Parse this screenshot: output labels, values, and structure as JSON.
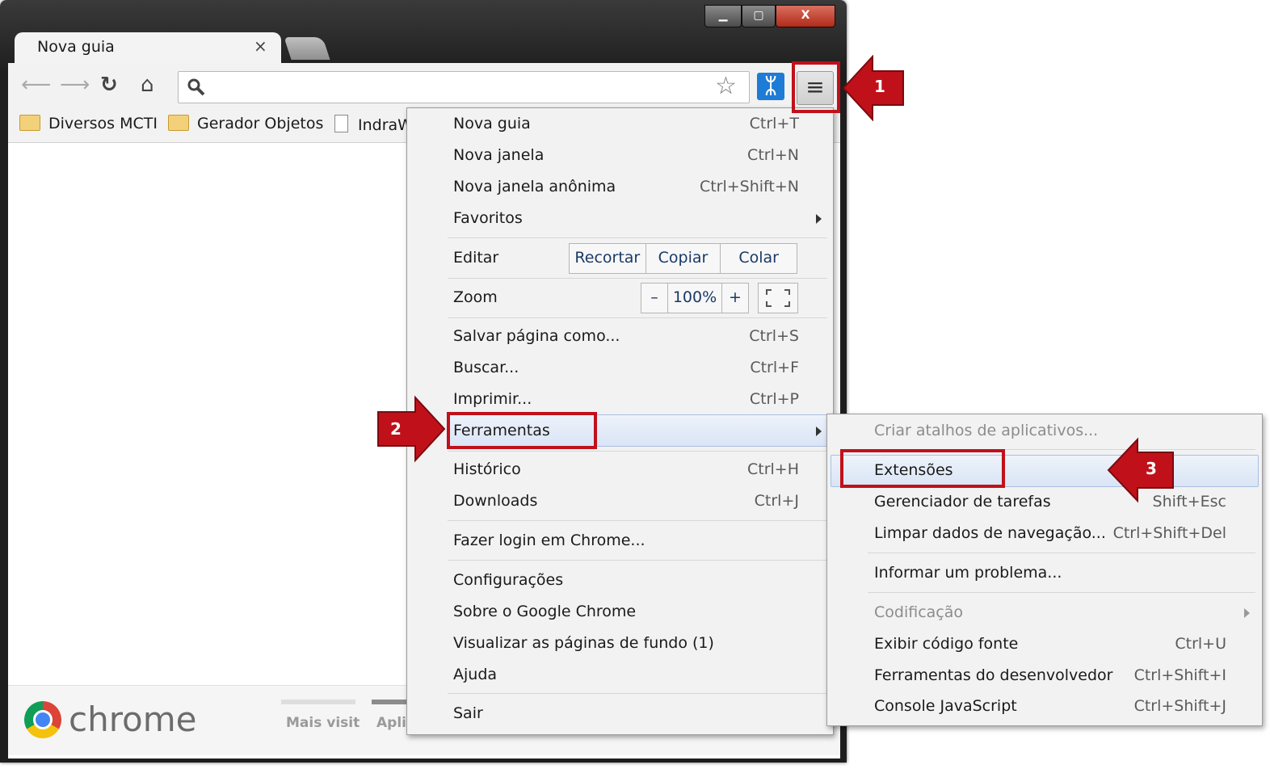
{
  "window": {
    "controls": {
      "minimize": "▁",
      "maximize": "▢",
      "close": "X"
    },
    "tab": {
      "title": "Nova guia",
      "close": "×"
    }
  },
  "toolbar": {
    "back_icon": "arrow-left-icon",
    "forward_icon": "arrow-right-icon",
    "reload_icon": "reload-icon",
    "home_icon": "home-icon",
    "search_icon": "search-icon",
    "star_icon": "star-icon",
    "menu_icon": "hamburger-menu-icon"
  },
  "bookmarks": [
    {
      "label": "Diversos MCTI",
      "icon": "folder-icon"
    },
    {
      "label": "Gerador Objetos",
      "icon": "folder-icon"
    },
    {
      "label": "IndraW",
      "icon": "page-icon"
    }
  ],
  "footer": {
    "brand": "chrome",
    "tab1": "Mais visit",
    "tab2": "Apli"
  },
  "main_menu": {
    "items": [
      {
        "label": "Nova guia",
        "shortcut": "Ctrl+T"
      },
      {
        "label": "Nova janela",
        "shortcut": "Ctrl+N"
      },
      {
        "label": "Nova janela anônima",
        "shortcut": "Ctrl+Shift+N"
      },
      {
        "label": "Favoritos",
        "shortcut": ""
      }
    ],
    "edit": {
      "label": "Editar",
      "cut": "Recortar",
      "copy": "Copiar",
      "paste": "Colar"
    },
    "zoom": {
      "label": "Zoom",
      "minus": "–",
      "value": "100%",
      "plus": "+"
    },
    "items2": [
      {
        "label": "Salvar página como...",
        "shortcut": "Ctrl+S"
      },
      {
        "label": "Buscar...",
        "shortcut": "Ctrl+F"
      },
      {
        "label": "Imprimir...",
        "shortcut": "Ctrl+P"
      },
      {
        "label": "Ferramentas",
        "shortcut": ""
      }
    ],
    "items3": [
      {
        "label": "Histórico",
        "shortcut": "Ctrl+H"
      },
      {
        "label": "Downloads",
        "shortcut": "Ctrl+J"
      }
    ],
    "signin": "Fazer login em Chrome...",
    "items4": [
      {
        "label": "Configurações"
      },
      {
        "label": "Sobre o Google Chrome"
      },
      {
        "label": "Visualizar as páginas de fundo (1)"
      },
      {
        "label": "Ajuda"
      }
    ],
    "exit": "Sair"
  },
  "sub_menu": {
    "create_shortcuts": "Criar atalhos de aplicativos...",
    "items": [
      {
        "label": "Extensões",
        "shortcut": ""
      },
      {
        "label": "Gerenciador de tarefas",
        "shortcut": "Shift+Esc"
      },
      {
        "label": "Limpar dados de navegação...",
        "shortcut": "Ctrl+Shift+Del"
      }
    ],
    "report": "Informar um problema...",
    "encoding": "Codificação",
    "items2": [
      {
        "label": "Exibir código fonte",
        "shortcut": "Ctrl+U"
      },
      {
        "label": "Ferramentas do desenvolvedor",
        "shortcut": "Ctrl+Shift+I"
      },
      {
        "label": "Console JavaScript",
        "shortcut": "Ctrl+Shift+J"
      }
    ]
  },
  "callouts": [
    "1",
    "2",
    "3"
  ],
  "colors": {
    "callout_red": "#c0111a",
    "highlight": "#d9e4f5"
  }
}
